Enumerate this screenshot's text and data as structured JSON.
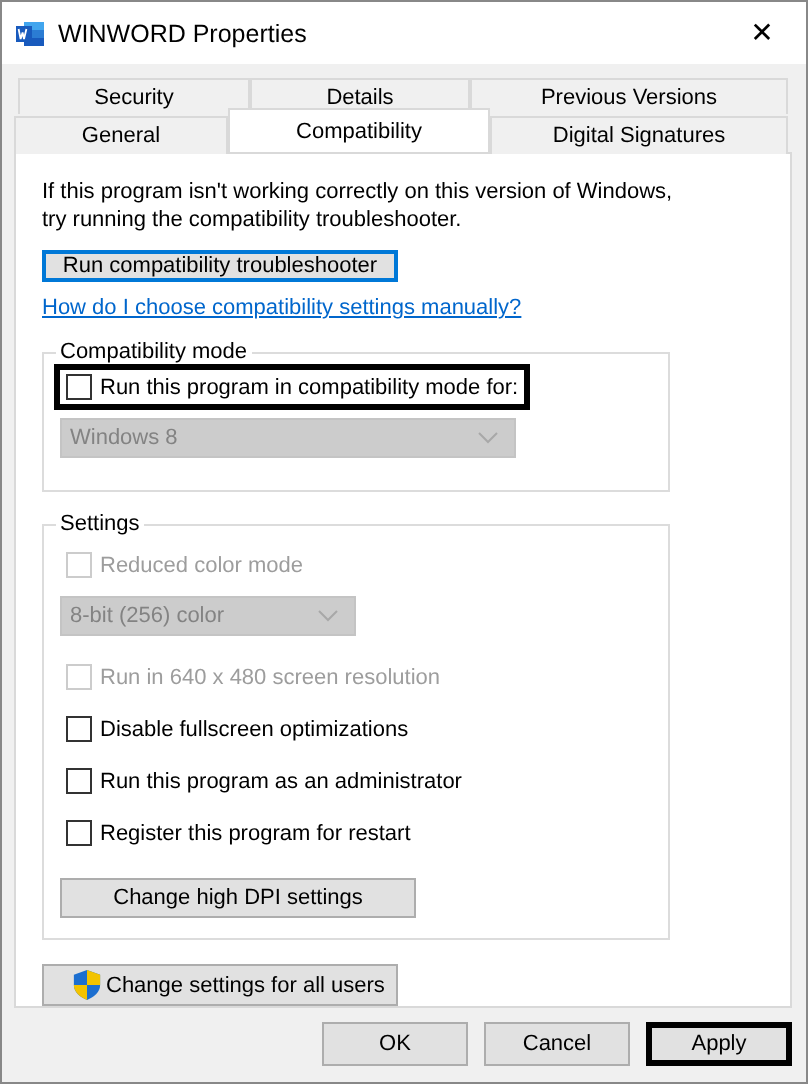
{
  "window": {
    "title": "WINWORD Properties",
    "close": "✕"
  },
  "tabs": [
    [
      {
        "label": "Security",
        "selected": false
      },
      {
        "label": "Details",
        "selected": false
      },
      {
        "label": "Previous Versions",
        "selected": false
      }
    ],
    [
      {
        "label": "General",
        "selected": false
      },
      {
        "label": "Compatibility",
        "selected": true
      },
      {
        "label": "Digital Signatures",
        "selected": false
      }
    ]
  ],
  "intro": [
    "If this program isn't working correctly on this version of Windows,",
    "try running the compatibility troubleshooter."
  ],
  "troubleshooter_button": {
    "label": "Run compatibility troubleshooter",
    "focused": true
  },
  "help_link": "How do I choose compatibility settings manually?",
  "groups": [
    {
      "title": "Compatibility mode",
      "items": [
        {
          "kind": "checkbox",
          "label": "Run this program in compatibility mode for:",
          "checked": false,
          "disabled": false,
          "highlighted": true
        },
        {
          "kind": "select",
          "value": "Windows 8",
          "disabled": true,
          "wide": true
        }
      ]
    },
    {
      "title": "Settings",
      "items": [
        {
          "kind": "checkbox",
          "label": "Reduced color mode",
          "checked": false,
          "disabled": true,
          "highlighted": false
        },
        {
          "kind": "select",
          "value": "8-bit (256) color",
          "disabled": true,
          "wide": false
        },
        {
          "kind": "checkbox",
          "label": "Run in 640 x 480 screen resolution",
          "checked": false,
          "disabled": true,
          "highlighted": false
        },
        {
          "kind": "checkbox",
          "label": "Disable fullscreen optimizations",
          "checked": false,
          "disabled": false,
          "highlighted": false
        },
        {
          "kind": "checkbox",
          "label": "Run this program as an administrator",
          "checked": false,
          "disabled": false,
          "highlighted": false
        },
        {
          "kind": "checkbox",
          "label": "Register this program for restart",
          "checked": false,
          "disabled": false,
          "highlighted": false
        },
        {
          "kind": "button",
          "label": "Change high DPI settings"
        }
      ]
    }
  ],
  "all_users_button": "Change settings for all users",
  "buttons": [
    {
      "label": "OK",
      "highlighted": false
    },
    {
      "label": "Cancel",
      "highlighted": false
    },
    {
      "label": "Apply",
      "highlighted": true
    }
  ]
}
